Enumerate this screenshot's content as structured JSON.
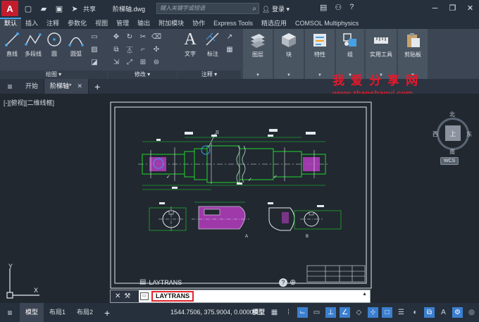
{
  "titlebar": {
    "app_letter": "A",
    "share_label": "共享",
    "document_title": "阶梯轴.dwg",
    "search_placeholder": "键入关键字或短语",
    "login_label": "登录"
  },
  "ribbon_tabs": [
    {
      "label": "默认",
      "active": true
    },
    {
      "label": "插入"
    },
    {
      "label": "注释"
    },
    {
      "label": "参数化"
    },
    {
      "label": "视图"
    },
    {
      "label": "管理"
    },
    {
      "label": "输出"
    },
    {
      "label": "附加模块"
    },
    {
      "label": "协作"
    },
    {
      "label": "Express Tools"
    },
    {
      "label": "精选应用"
    },
    {
      "label": "COMSOL Multiphysics"
    }
  ],
  "ribbon": {
    "draw": {
      "buttons": [
        "直线",
        "多段线",
        "圆",
        "圆弧"
      ],
      "title": "绘图"
    },
    "modify": {
      "title": "修改"
    },
    "annotation": {
      "buttons": [
        "文字",
        "标注"
      ],
      "title": "注释"
    },
    "layers": "图层",
    "block": "块",
    "properties": "特性",
    "groups": "组",
    "utilities": "实用工具",
    "clipboard": "剪贴板"
  },
  "file_tabs": {
    "start": "开始",
    "current": "阶梯轴*"
  },
  "watermark": {
    "line1": "我爱分享网",
    "line2": "www.zhanshaoyi.com"
  },
  "canvas": {
    "view_label": "[-][俯视][二维线框]",
    "viewcube": {
      "north": "北",
      "south": "南",
      "east": "东",
      "west": "西",
      "face": "上",
      "wcs": "WCS"
    },
    "drawing_callout": "II"
  },
  "command": {
    "history": "LAYTRANS",
    "input": "LAYTRANS"
  },
  "statusbar": {
    "tabs": [
      "模型",
      "布局1",
      "布局2"
    ],
    "coordinates": "1544.7506, 375.9004, 0.0000",
    "model_label": "模型"
  },
  "colors": {
    "accent": "#45a1e5",
    "drawing_green": "#1fd62c",
    "drawing_magenta": "#c53fd0",
    "highlight_red": "#e3242b"
  }
}
